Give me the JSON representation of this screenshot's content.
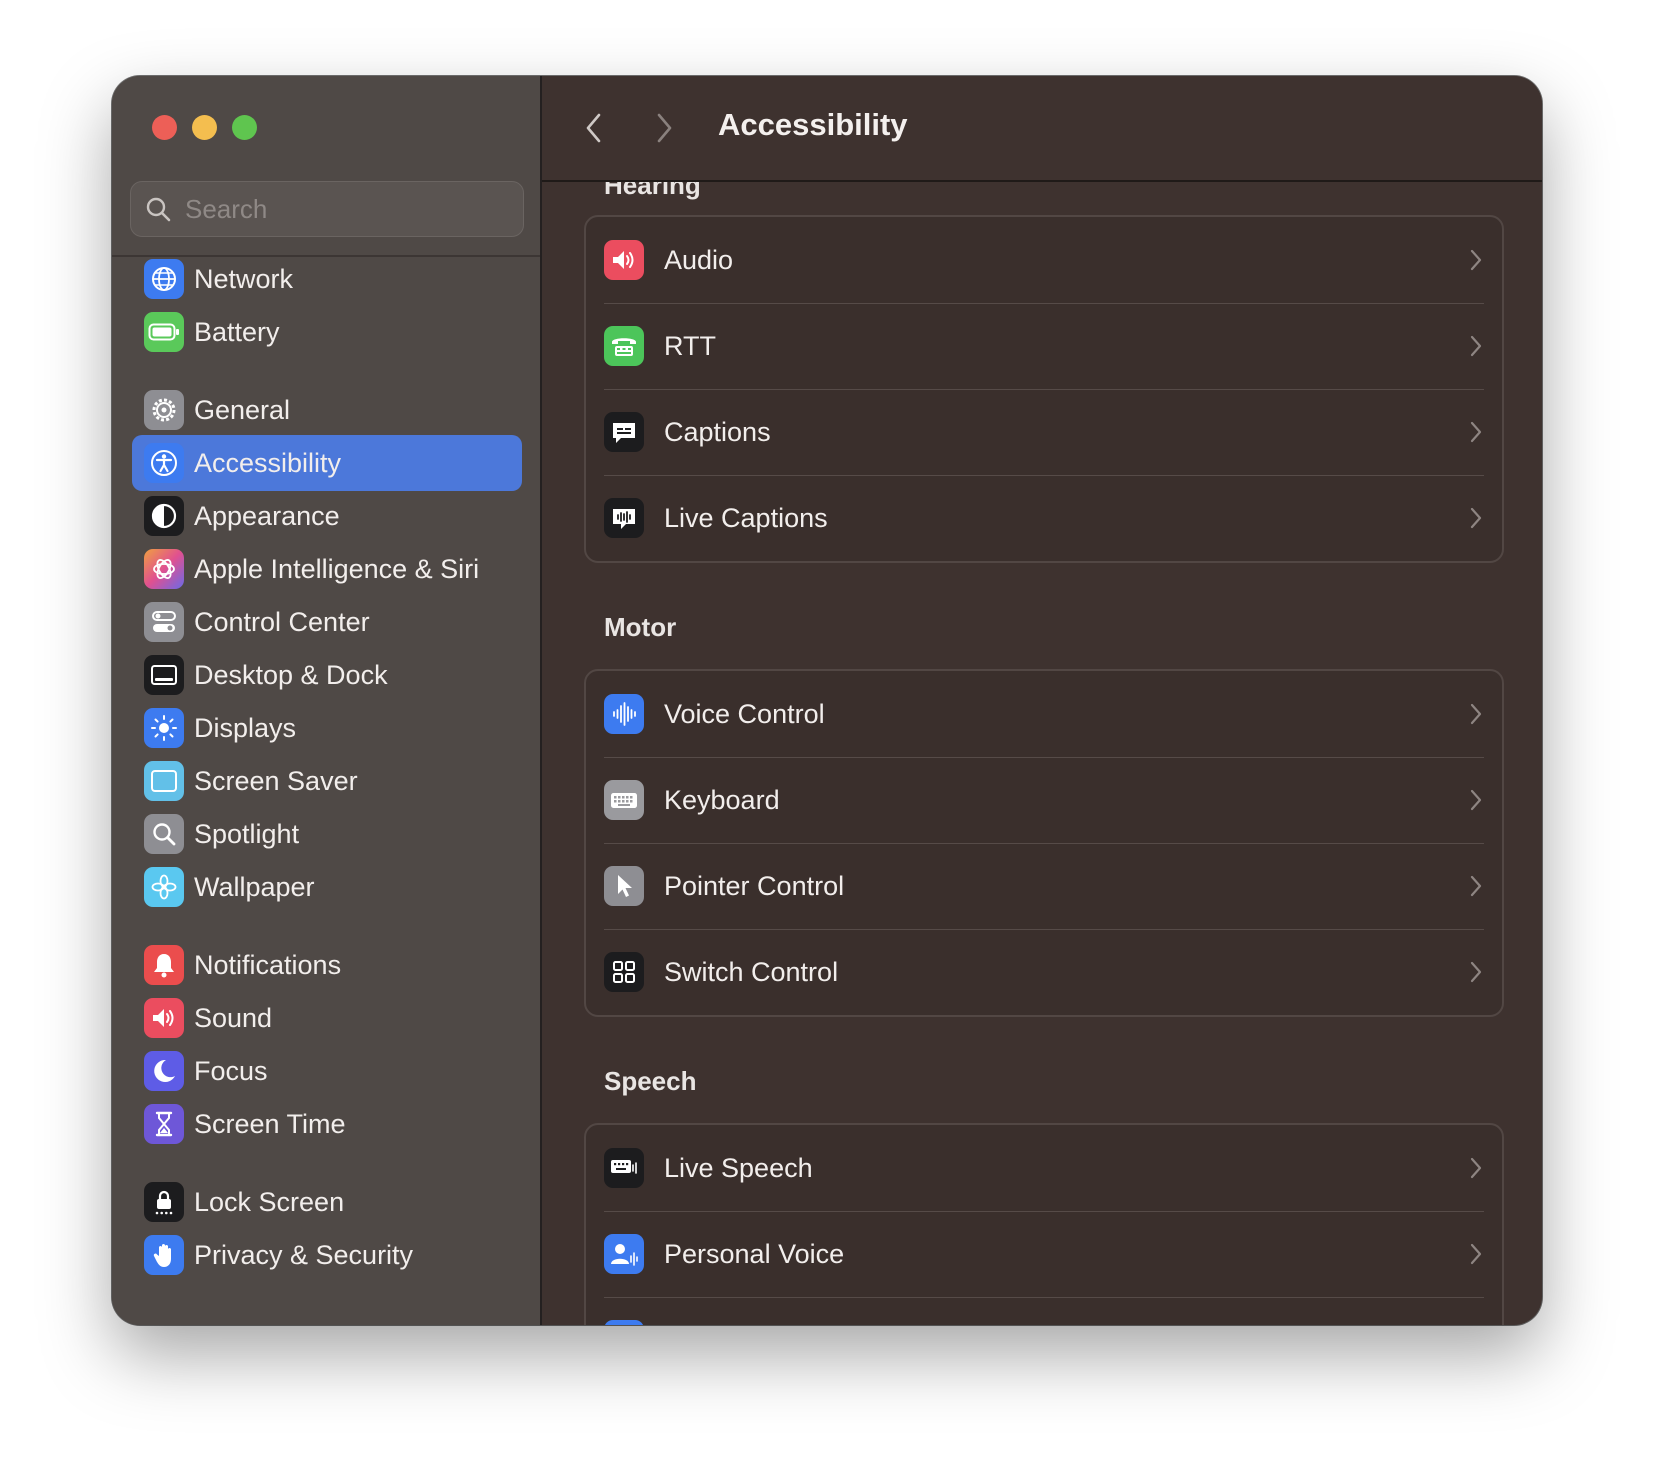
{
  "window": {
    "traffic_lights": {
      "close": "#ed5f57",
      "minimize": "#f4be4f",
      "maximize": "#5fc54f"
    }
  },
  "search": {
    "placeholder": "Search"
  },
  "sidebar": {
    "accent": "#4c78da",
    "items": [
      {
        "label": "Network",
        "icon": "globe-icon",
        "color": "#3d7bf0"
      },
      {
        "label": "Battery",
        "icon": "battery-icon",
        "color": "#5ac95a"
      },
      {
        "label": "General",
        "icon": "gear-icon",
        "color": "#8e8e93"
      },
      {
        "label": "Accessibility",
        "icon": "accessibility-icon",
        "color": "#3d7bf0",
        "selected": true
      },
      {
        "label": "Appearance",
        "icon": "appearance-icon",
        "color": "#1c1c1e"
      },
      {
        "label": "Apple Intelligence & Siri",
        "icon": "siri-icon",
        "color": "#e070c0"
      },
      {
        "label": "Control Center",
        "icon": "toggles-icon",
        "color": "#8e8e93"
      },
      {
        "label": "Desktop & Dock",
        "icon": "dock-icon",
        "color": "#1c1c1e"
      },
      {
        "label": "Displays",
        "icon": "sun-icon",
        "color": "#3d7bf0"
      },
      {
        "label": "Screen Saver",
        "icon": "screen-saver-icon",
        "color": "#62c0e8"
      },
      {
        "label": "Spotlight",
        "icon": "magnifier-icon",
        "color": "#8e8e93"
      },
      {
        "label": "Wallpaper",
        "icon": "flower-icon",
        "color": "#5ac8f0"
      },
      {
        "label": "Notifications",
        "icon": "bell-icon",
        "color": "#eb4d4d"
      },
      {
        "label": "Sound",
        "icon": "speaker-icon",
        "color": "#eb4d5f"
      },
      {
        "label": "Focus",
        "icon": "moon-icon",
        "color": "#5e5ce6"
      },
      {
        "label": "Screen Time",
        "icon": "hourglass-icon",
        "color": "#6e57d8"
      },
      {
        "label": "Lock Screen",
        "icon": "lock-icon",
        "color": "#1c1c1e"
      },
      {
        "label": "Privacy & Security",
        "icon": "hand-icon",
        "color": "#3d7bf0"
      }
    ]
  },
  "toolbar": {
    "title": "Accessibility"
  },
  "sections": [
    {
      "title": "Hearing",
      "rows": [
        {
          "label": "Audio",
          "icon": "speaker-icon",
          "color": "#eb4d5f"
        },
        {
          "label": "RTT",
          "icon": "rtt-phone-icon",
          "color": "#4cc55a"
        },
        {
          "label": "Captions",
          "icon": "captions-icon",
          "color": "#1c1c1e"
        },
        {
          "label": "Live Captions",
          "icon": "live-captions-icon",
          "color": "#1c1c1e"
        }
      ]
    },
    {
      "title": "Motor",
      "rows": [
        {
          "label": "Voice Control",
          "icon": "waveform-icon",
          "color": "#3d7bf0"
        },
        {
          "label": "Keyboard",
          "icon": "keyboard-icon",
          "color": "#9a9a9e"
        },
        {
          "label": "Pointer Control",
          "icon": "pointer-icon",
          "color": "#8e8e93"
        },
        {
          "label": "Switch Control",
          "icon": "switch-grid-icon",
          "color": "#1c1c1e"
        }
      ]
    },
    {
      "title": "Speech",
      "rows": [
        {
          "label": "Live Speech",
          "icon": "live-speech-icon",
          "color": "#1c1c1e"
        },
        {
          "label": "Personal Voice",
          "icon": "personal-voice-icon",
          "color": "#3d7bf0"
        }
      ]
    }
  ]
}
